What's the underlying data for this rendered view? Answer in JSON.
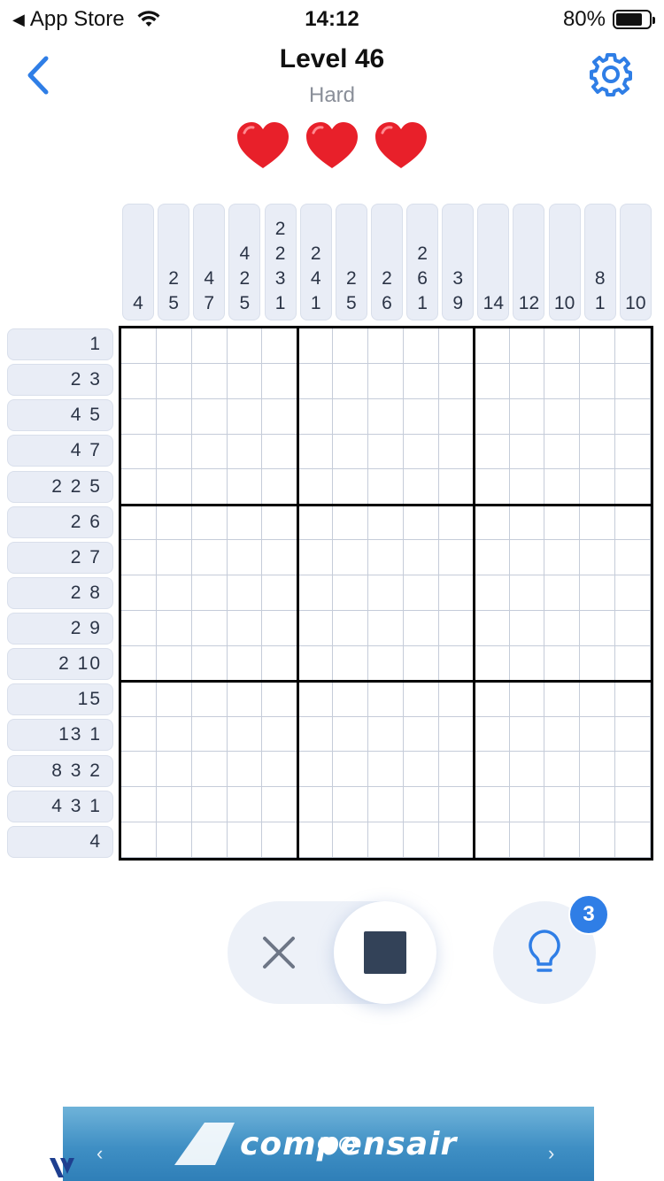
{
  "status_bar": {
    "back_app": "App Store",
    "time": "14:12",
    "battery": "80%",
    "battery_level": 0.8
  },
  "header": {
    "title": "Level 46",
    "difficulty": "Hard",
    "lives": 3,
    "back_icon": "chevron-left-icon",
    "settings_icon": "gear-icon"
  },
  "puzzle": {
    "size": 15,
    "column_clues": [
      [
        "4"
      ],
      [
        "2",
        "5"
      ],
      [
        "4",
        "7"
      ],
      [
        "4",
        "2",
        "5"
      ],
      [
        "2",
        "2",
        "3",
        "1"
      ],
      [
        "2",
        "4",
        "1"
      ],
      [
        "2",
        "5"
      ],
      [
        "2",
        "6"
      ],
      [
        "2",
        "6",
        "1"
      ],
      [
        "3",
        "9"
      ],
      [
        "14"
      ],
      [
        "12"
      ],
      [
        "10"
      ],
      [
        "8",
        "1"
      ],
      [
        "10"
      ]
    ],
    "row_clues": [
      "1",
      "2 3",
      "4 5",
      "4 7",
      "2 2 5",
      "2 6",
      "2 7",
      "2 8",
      "2 9",
      "2 10",
      "15",
      "13 1",
      "8 3 2",
      "4 3 1",
      "4"
    ]
  },
  "controls": {
    "mode_cross_icon": "close-icon",
    "mode_fill_icon": "filled-square-icon",
    "active_mode": "fill",
    "hint_icon": "lightbulb-icon",
    "hint_count": "3"
  },
  "ad": {
    "brand": "compensair"
  },
  "colors": {
    "accent": "#2f7ee6",
    "clue_bg": "#e9edf6",
    "heart": "#e8202a",
    "fill_square": "#334258"
  }
}
